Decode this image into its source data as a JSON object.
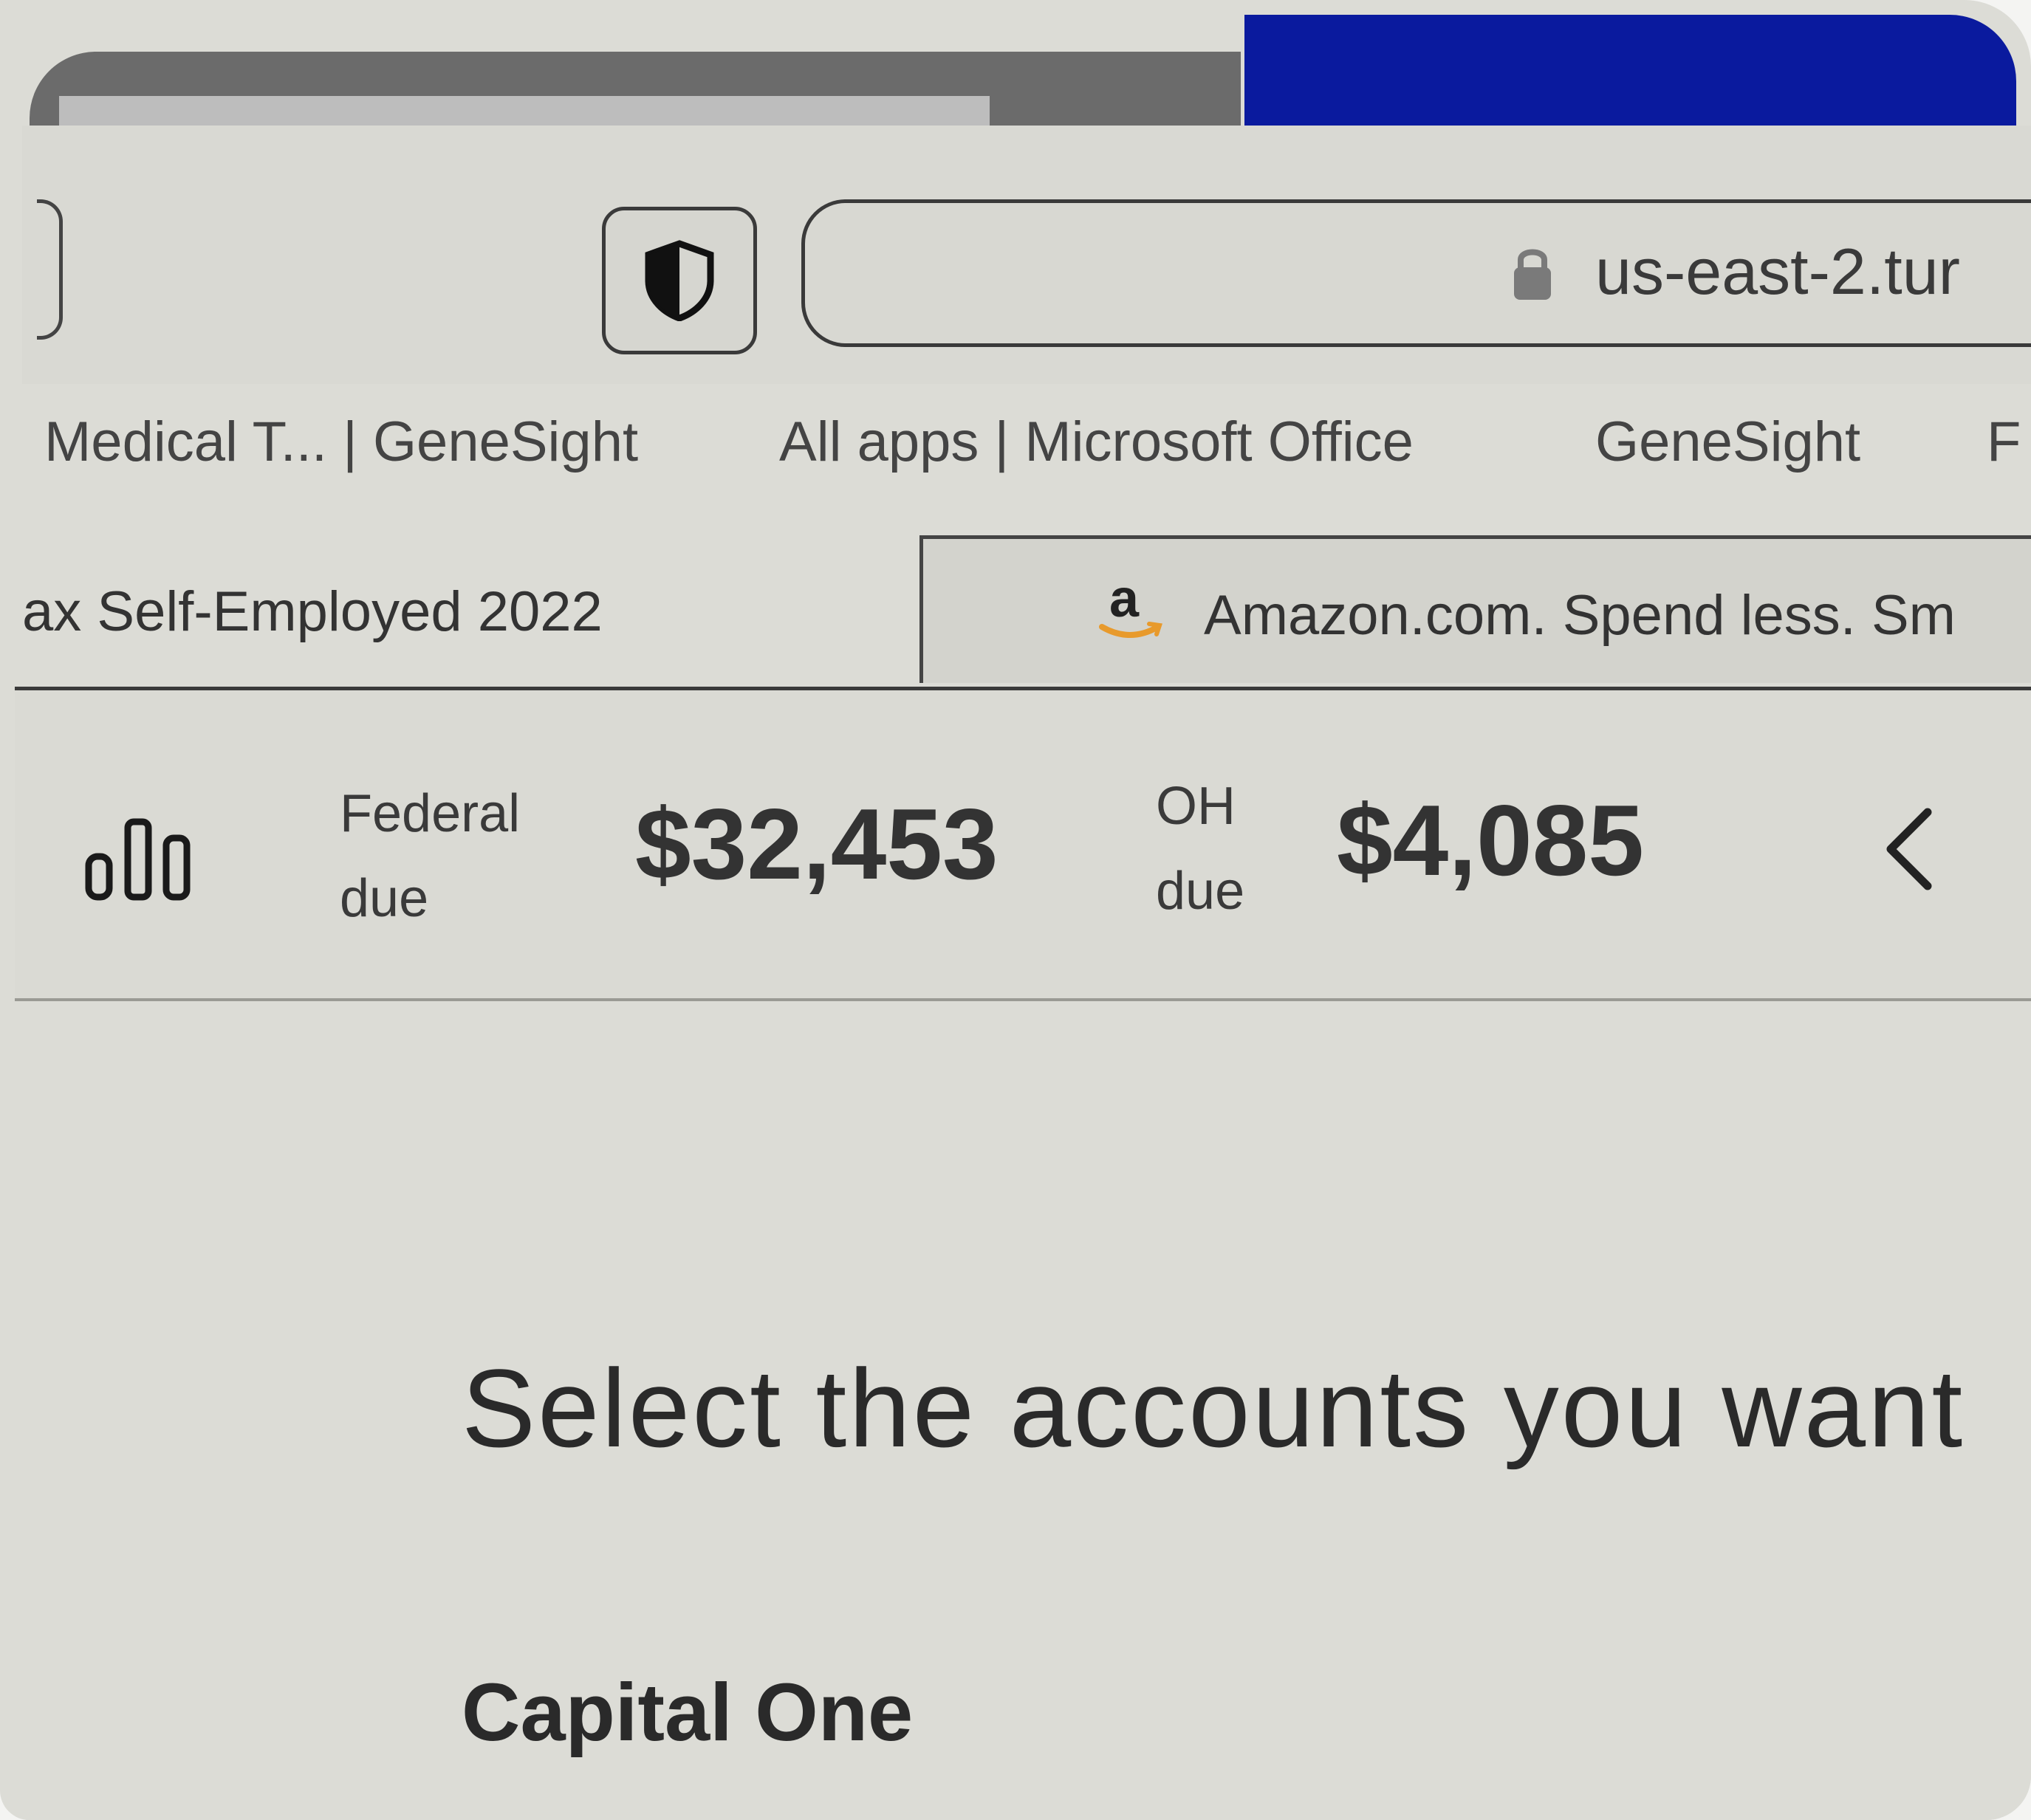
{
  "colors": {
    "top_strip_right": "#0a1a9e",
    "top_strip_left": "#6b6b6b",
    "background": "#dcdcd6",
    "text": "#2a2a2a"
  },
  "browser": {
    "shield_icon": "shield-half-icon",
    "lock_icon": "lock-icon",
    "url": "us-east-2.tur",
    "bookmarks": [
      {
        "label": "Medical T... | GeneSight"
      },
      {
        "label": "All apps | Microsoft Office"
      },
      {
        "label": "GeneSight"
      },
      {
        "label": "F"
      }
    ],
    "tabs": [
      {
        "title": "ax Self-Employed 2022"
      },
      {
        "title": "Amazon.com. Spend less. Sm",
        "icon": "amazon-icon",
        "icon_letter": "a"
      }
    ]
  },
  "tax_summary": {
    "chart_icon": "bar-chart-icon",
    "federal": {
      "label_line1": "Federal",
      "label_line2": "due",
      "amount": "$32,453"
    },
    "state": {
      "label_line1": "OH",
      "label_line2": "due",
      "amount": "$4,085"
    },
    "collapse_icon": "chevron-left-icon"
  },
  "main": {
    "heading": "Select the accounts you want",
    "accounts": [
      {
        "name": "Capital One"
      }
    ]
  }
}
